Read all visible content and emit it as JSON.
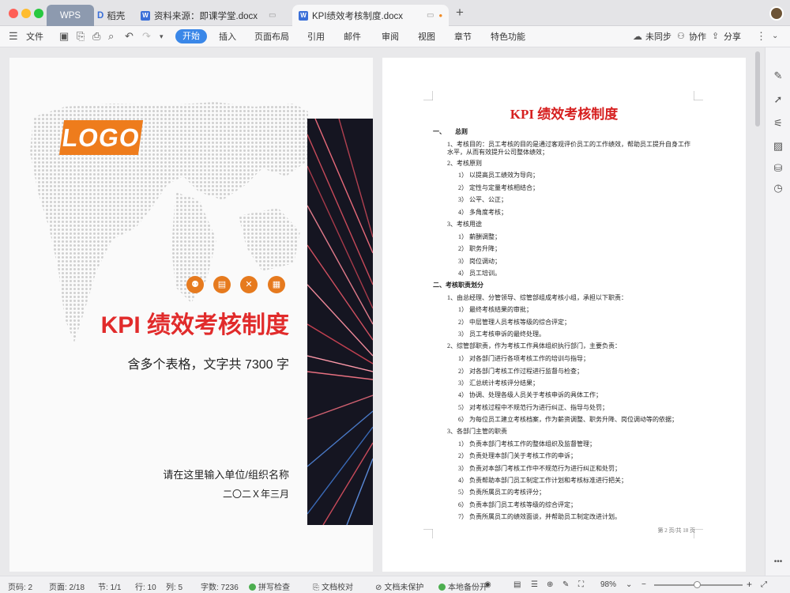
{
  "tabs": {
    "wps": "WPS",
    "daoke": "稻壳",
    "doc1": "资料来源：即课学堂.docx",
    "doc2": "KPI绩效考核制度.docx"
  },
  "toolbar": {
    "file": "文件",
    "start": "开始",
    "insert": "插入",
    "layout": "页面布局",
    "ref": "引用",
    "mail": "邮件",
    "review": "审阅",
    "view": "视图",
    "chapter": "章节",
    "special": "特色功能",
    "sync": "未同步",
    "collab": "协作",
    "share": "分享"
  },
  "cover": {
    "logo": "LOGO",
    "title": "KPI 绩效考核制度",
    "subtitle": "含多个表格，文字共 7300 字",
    "org": "请在这里输入单位/组织名称",
    "date": "二〇二Ｘ年三月"
  },
  "doc": {
    "title": "KPI 绩效考核制度",
    "page_number": "第 2 页/共 18 页",
    "lines": [
      "一、　　总则",
      "1、考核目的：员工考核的目的是通过客观评价员工的工作绩效，帮助员工提升自身工作",
      "水平，从而有效提升公司整体绩效；",
      "2、考核原则",
      "1） 以提高员工绩效为导向；",
      "2） 定性与定量考核相结合；",
      "3） 公平、公正；",
      "4） 多角度考核；",
      "3、考核用途",
      "1） 薪酬调整；",
      "2） 职务升降；",
      "3） 岗位调动；",
      "4） 员工培训。",
      "二、考核职责划分",
      "1、由总经理、分管领导、综管部组成考核小组，承担以下职责：",
      "1） 最终考核结果的审批；",
      "2） 中层管理人员考核等级的综合评定；",
      "3） 员工考核申诉的最终处理。",
      "2、综管部职责，作为考核工作具体组织执行部门，主要负责：",
      "1） 对各部门进行各项考核工作的培训与指导；",
      "2） 对各部门考核工作过程进行监督与检查；",
      "3） 汇总统计考核评分结果；",
      "4） 协调、处理各级人员关于考核申诉的具体工作；",
      "5） 对考核过程中不规范行为进行纠正、指导与处罚；",
      "6） 为每位员工建立考核档案，作为薪资调整、职务升降、岗位调动等的依据；",
      "3、各部门主管的职责",
      "1） 负责本部门考核工作的整体组织及监督管理；",
      "2） 负责处理本部门关于考核工作的申诉；",
      "3） 负责对本部门考核工作中不规范行为进行纠正和处罚；",
      "4） 负责帮助本部门员工制定工作计划和考核标准进行把关；",
      "5） 负责所属员工的考核评分；",
      "6） 负责本部门员工考核等级的综合评定；",
      "7） 负责所属员工的绩效面谈，并帮助员工制定改进计划。"
    ]
  },
  "status": {
    "page_code": "页码: 2",
    "page": "页面: 2/18",
    "section": "节: 1/1",
    "row": "行: 10",
    "col": "列: 5",
    "words": "字数: 7236",
    "spell": "拼写检查",
    "proof": "文档校对",
    "protect": "文档未保护",
    "backup": "本地备份开",
    "zoom": "98%"
  },
  "colors": {
    "accent": "#3a87e8",
    "orange": "#e67a1e",
    "red": "#e12b2b"
  }
}
